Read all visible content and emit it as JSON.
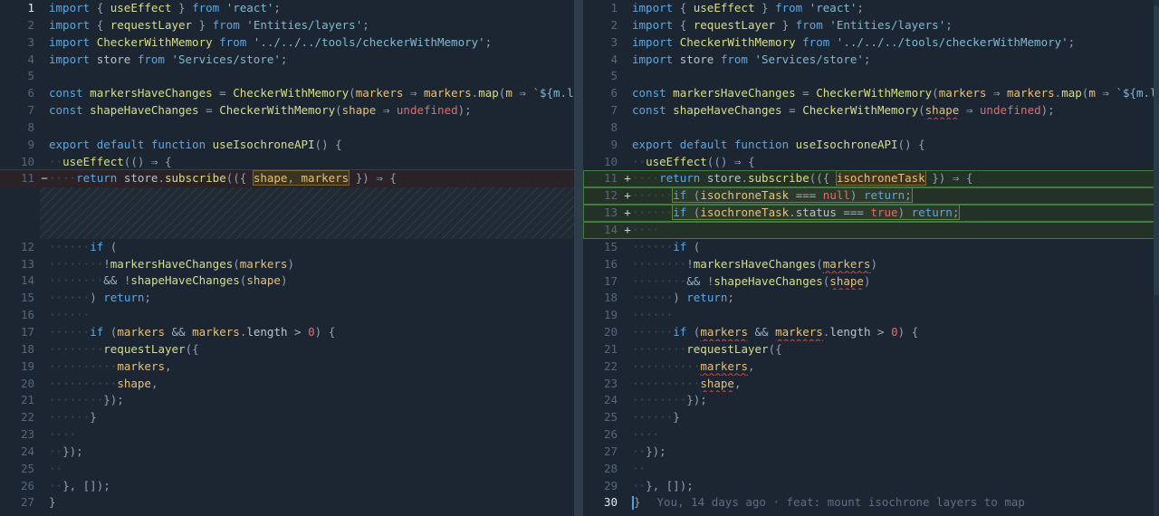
{
  "left": {
    "lines": [
      {
        "n": "1",
        "t": "import { useEffect } from 'react';"
      },
      {
        "n": "2",
        "t": "import { requestLayer } from 'Entities/layers';"
      },
      {
        "n": "3",
        "t": "import CheckerWithMemory from '../../../tools/checkerWithMemory';"
      },
      {
        "n": "4",
        "t": "import store from 'Services/store';"
      },
      {
        "n": "5",
        "t": ""
      },
      {
        "n": "6",
        "t": "const markersHaveChanges = CheckerWithMemory(markers ⇒ markers.map(m ⇒ `${m.lng}-${m."
      },
      {
        "n": "7",
        "t": "const shapeHaveChanges = CheckerWithMemory(shape ⇒ undefined);"
      },
      {
        "n": "8",
        "t": ""
      },
      {
        "n": "9",
        "t": "export default function useIsochroneAPI() {"
      },
      {
        "n": "10",
        "t": "useEffect(() ⇒ {"
      },
      {
        "n": "11",
        "t": "return store.subscribe(({ shape, markers }) ⇒ {",
        "mark": "−"
      },
      {
        "n": "12",
        "t": "if ("
      },
      {
        "n": "13",
        "t": "!markersHaveChanges(markers)"
      },
      {
        "n": "14",
        "t": "&& !shapeHaveChanges(shape)"
      },
      {
        "n": "15",
        "t": ") return;"
      },
      {
        "n": "16",
        "t": ""
      },
      {
        "n": "17",
        "t": "if (markers && markers.length > 0) {"
      },
      {
        "n": "18",
        "t": "requestLayer({"
      },
      {
        "n": "19",
        "t": "markers,"
      },
      {
        "n": "20",
        "t": "shape,"
      },
      {
        "n": "21",
        "t": "});"
      },
      {
        "n": "22",
        "t": "}"
      },
      {
        "n": "23",
        "t": ""
      },
      {
        "n": "24",
        "t": "});"
      },
      {
        "n": "25",
        "t": ""
      },
      {
        "n": "26",
        "t": "}, []);"
      },
      {
        "n": "27",
        "t": "}"
      }
    ]
  },
  "right": {
    "lines": [
      {
        "n": "1",
        "t": "import { useEffect } from 'react';"
      },
      {
        "n": "2",
        "t": "import { requestLayer } from 'Entities/layers';"
      },
      {
        "n": "3",
        "t": "import CheckerWithMemory from '../../../tools/checkerWithMemory';"
      },
      {
        "n": "4",
        "t": "import store from 'Services/store';"
      },
      {
        "n": "5",
        "t": ""
      },
      {
        "n": "6",
        "t": "const markersHaveChanges = CheckerWithMemory(markers ⇒ markers.map(m ⇒ `${m.lng}-${m"
      },
      {
        "n": "7",
        "t": "const shapeHaveChanges = CheckerWithMemory(shape ⇒ undefined);"
      },
      {
        "n": "8",
        "t": ""
      },
      {
        "n": "9",
        "t": "export default function useIsochroneAPI() {"
      },
      {
        "n": "10",
        "t": "useEffect(() ⇒ {"
      },
      {
        "n": "11",
        "t": "return store.subscribe(({ isochroneTask }) ⇒ {",
        "mark": "+"
      },
      {
        "n": "12",
        "t": "if (isochroneTask === null) return;",
        "mark": "+"
      },
      {
        "n": "13",
        "t": "if (isochroneTask.status === true) return;",
        "mark": "+"
      },
      {
        "n": "14",
        "t": "",
        "mark": "+"
      },
      {
        "n": "15",
        "t": "if ("
      },
      {
        "n": "16",
        "t": "!markersHaveChanges(markers)"
      },
      {
        "n": "17",
        "t": "&& !shapeHaveChanges(shape)"
      },
      {
        "n": "18",
        "t": ") return;"
      },
      {
        "n": "19",
        "t": ""
      },
      {
        "n": "20",
        "t": "if (markers && markers.length > 0) {"
      },
      {
        "n": "21",
        "t": "requestLayer({"
      },
      {
        "n": "22",
        "t": "markers,"
      },
      {
        "n": "23",
        "t": "shape,"
      },
      {
        "n": "24",
        "t": "});"
      },
      {
        "n": "25",
        "t": "}"
      },
      {
        "n": "26",
        "t": ""
      },
      {
        "n": "27",
        "t": "});"
      },
      {
        "n": "28",
        "t": ""
      },
      {
        "n": "29",
        "t": "}, []);"
      },
      {
        "n": "30",
        "t": "}"
      }
    ],
    "blame": "You, 14 days ago · feat: mount isochrone layers to map"
  },
  "colors": {
    "background": "#1b2632",
    "removed_line": "#6e2a2e",
    "added_line": "#3e7d3e",
    "cursor": "#52a0e0"
  }
}
